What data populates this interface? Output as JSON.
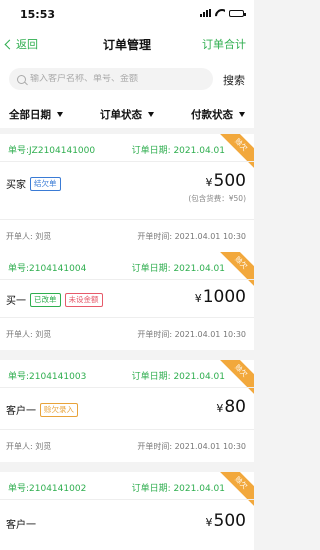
{
  "status_bar": {
    "time": "15:53"
  },
  "nav": {
    "back_label": "返回",
    "title": "订单管理",
    "action_label": "订单合计"
  },
  "search": {
    "placeholder": "输入客户名称、单号、金额",
    "button_label": "搜索"
  },
  "filters": [
    {
      "label": "全部日期"
    },
    {
      "label": "订单状态"
    },
    {
      "label": "付款状态"
    }
  ],
  "orders": [
    {
      "order_no": "单号:JZ2104141000",
      "order_date": "订单日期: 2021.04.01",
      "badge": "赊欠",
      "customer": "买家",
      "tags": [
        {
          "text": "结欠单",
          "color": "blue"
        }
      ],
      "currency": "¥",
      "amount": "500",
      "note": "(包含货费：¥50)",
      "opener": "开单人: 刘觅",
      "open_time": "开单时间: 2021.04.01 10:30"
    },
    {
      "order_no": "单号:2104141004",
      "order_date": "订单日期: 2021.04.01",
      "badge": "赊欠",
      "customer": "买一",
      "tags": [
        {
          "text": "已改单",
          "color": "green"
        },
        {
          "text": "未设金额",
          "color": "red"
        }
      ],
      "currency": "¥",
      "amount": "1000",
      "opener": "开单人: 刘觅",
      "open_time": "开单时间: 2021.04.01 10:30"
    },
    {
      "order_no": "单号:2104141003",
      "order_date": "订单日期: 2021.04.01",
      "badge": "赊欠",
      "customer": "客户一",
      "tags": [
        {
          "text": "赊欠录入",
          "color": "orange"
        }
      ],
      "currency": "¥",
      "amount": "80",
      "opener": "开单人: 刘觅",
      "open_time": "开单时间: 2021.04.01 10:30"
    },
    {
      "order_no": "单号:2104141002",
      "order_date": "订单日期: 2021.04.01",
      "badge": "赊欠",
      "customer": "客户一",
      "tags": [],
      "currency": "¥",
      "amount": "500"
    }
  ],
  "colors": {
    "accent": "#2fae4f",
    "badge": "#f2a83c",
    "background": "#f3f3f3"
  }
}
